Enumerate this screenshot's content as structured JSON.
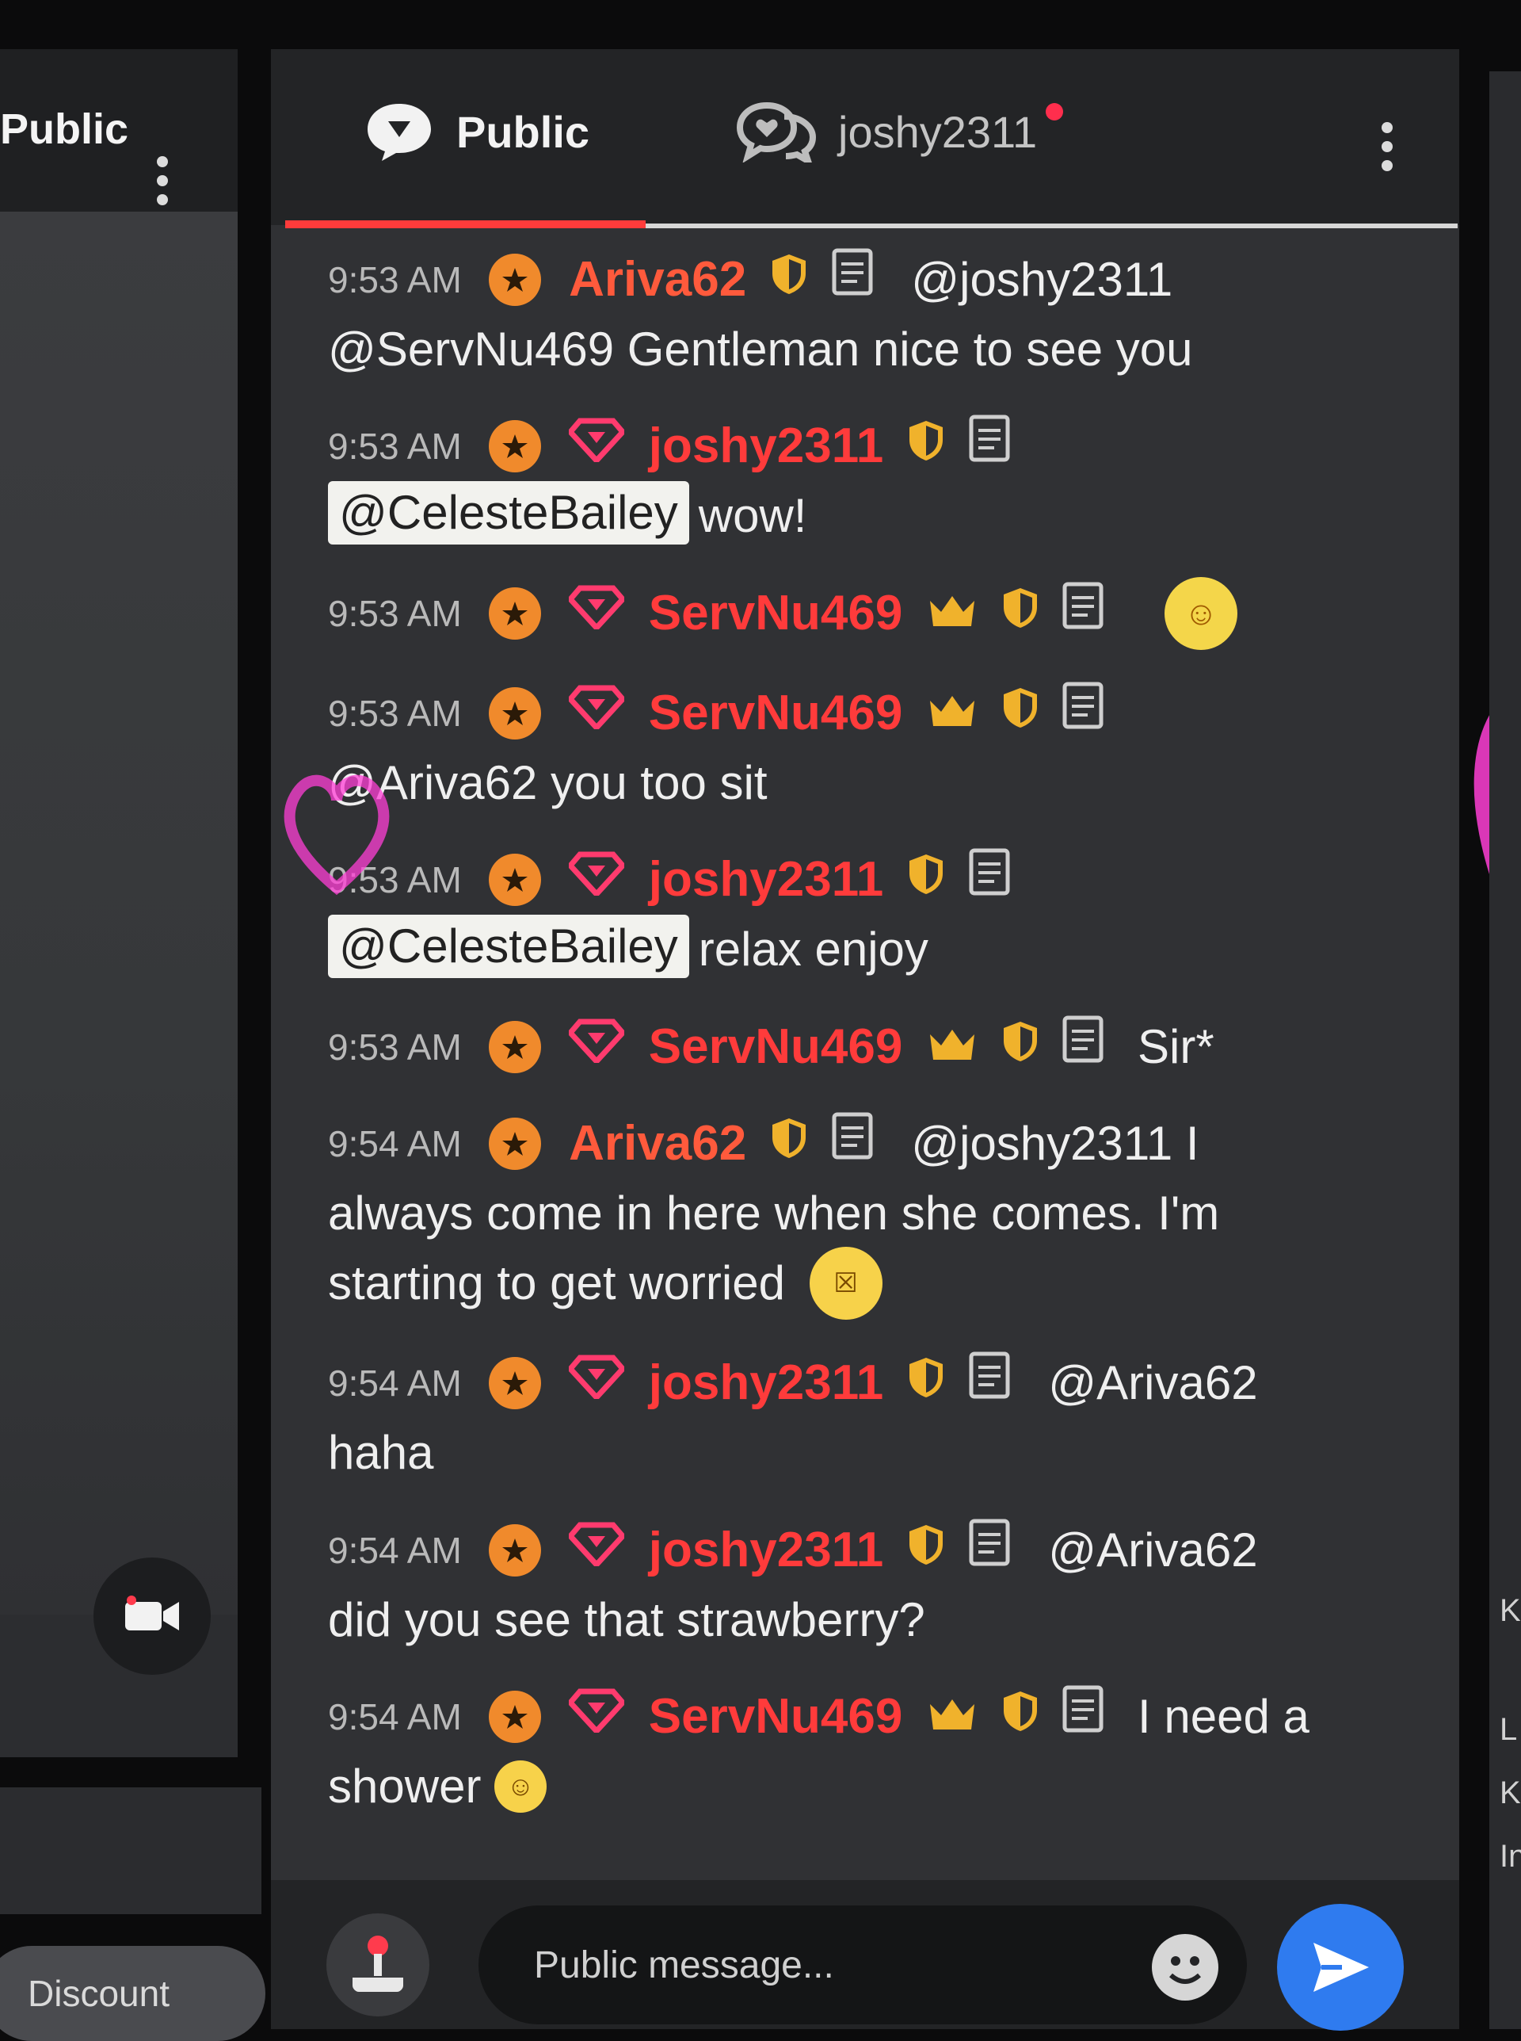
{
  "left_panel": {
    "tab_label": "Public",
    "discount_label": "Discount"
  },
  "chat": {
    "tabs": [
      {
        "label": "Public",
        "icon": "chat-bubble-icon",
        "active": true
      },
      {
        "label": "joshy2311",
        "icon": "private-chat-icon",
        "active": false,
        "has_notification": true
      }
    ],
    "messages": [
      {
        "time": "9:53 AM",
        "user": "Ariva62",
        "line1": "@joshy2311",
        "line2": "@ServNu469  Gentleman nice to see you"
      },
      {
        "time": "9:53 AM",
        "user": "joshy2311",
        "mention": "@CelesteBailey",
        "text": "wow!"
      },
      {
        "time": "9:53 AM",
        "user": "ServNu469",
        "emoji": "face-emoji"
      },
      {
        "time": "9:53 AM",
        "user": "ServNu469",
        "text": "@Ariva62  you too sit"
      },
      {
        "time": "9:53 AM",
        "user": "joshy2311",
        "mention": "@CelesteBailey",
        "text": "relax enjoy"
      },
      {
        "time": "9:53 AM",
        "user": "ServNu469",
        "text": "Sir*"
      },
      {
        "time": "9:54 AM",
        "user": "Ariva62",
        "line1": "@joshy2311 I",
        "line2": "always come in here when she comes. I'm",
        "line3": "starting to get worried"
      },
      {
        "time": "9:54 AM",
        "user": "joshy2311",
        "line1": "@Ariva62",
        "line2": "haha"
      },
      {
        "time": "9:54 AM",
        "user": "joshy2311",
        "line1": "@Ariva62",
        "line2": "did you see that strawberry?"
      },
      {
        "time": "9:54 AM",
        "user": "ServNu469",
        "line1": "I need a",
        "line2": "shower"
      }
    ],
    "input_placeholder": "Public message..."
  },
  "right_panel": {
    "letters": [
      "K",
      "L",
      "K",
      "In"
    ]
  },
  "colors": {
    "accent_red": "#ff3b3b",
    "send_blue": "#2f7bef",
    "star_orange": "#f08a2c"
  }
}
